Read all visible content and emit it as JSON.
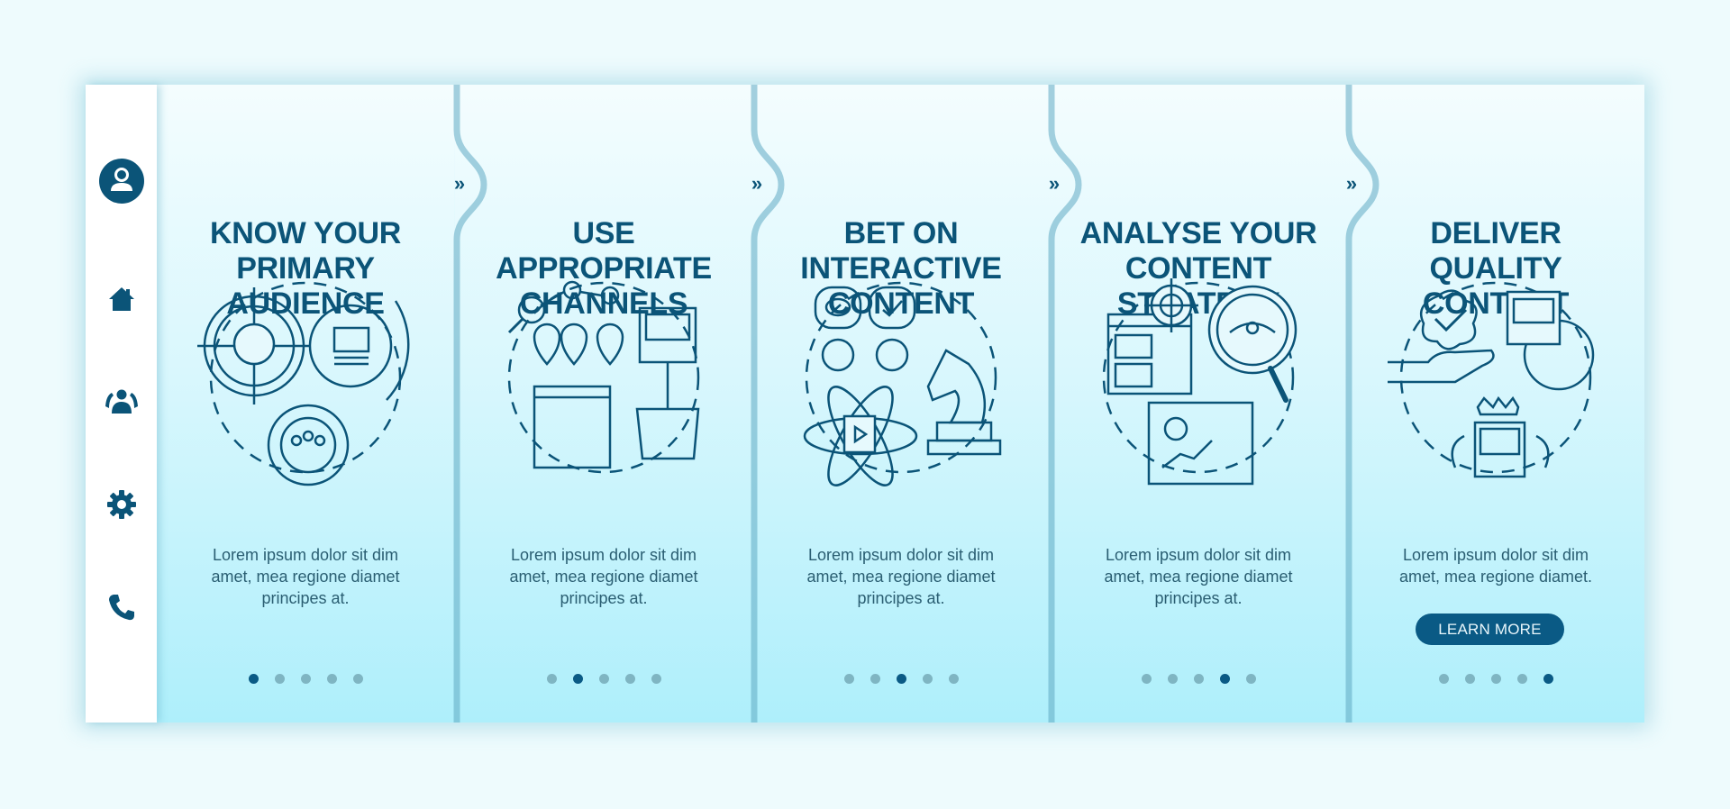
{
  "theme": {
    "primary": "#0b5478",
    "button": "#0a5a85",
    "dot_inactive": "#7fb5c2",
    "background": "#eefbfd",
    "panel_top": "#f4fdfe",
    "panel_bottom": "#aeeffb"
  },
  "sidebar": {
    "items": [
      {
        "icon": "user-icon",
        "label": "Profile"
      },
      {
        "icon": "home-icon",
        "label": "Home"
      },
      {
        "icon": "group-icon",
        "label": "Community"
      },
      {
        "icon": "gear-icon",
        "label": "Settings"
      },
      {
        "icon": "phone-icon",
        "label": "Contact"
      }
    ]
  },
  "next_chevron": "»",
  "panels": [
    {
      "title": [
        "KNOW YOUR",
        "PRIMARY",
        "AUDIENCE"
      ],
      "body": [
        "Lorem ipsum dolor sit dim",
        "amet, mea regione diamet",
        "principes at."
      ],
      "illustration": "audience-target-illustration",
      "active_dot": 1
    },
    {
      "title": [
        "USE",
        "APPROPRIATE",
        "CHANNELS"
      ],
      "body": [
        "Lorem ipsum dolor sit dim",
        "amet, mea regione diamet",
        "principes at."
      ],
      "illustration": "channels-locations-illustration",
      "active_dot": 2
    },
    {
      "title": [
        "BET ON",
        "INTERACTIVE",
        "CONTENT"
      ],
      "body": [
        "Lorem ipsum dolor sit dim",
        "amet, mea regione diamet",
        "principes at."
      ],
      "illustration": "interactive-content-illustration",
      "active_dot": 3
    },
    {
      "title": [
        "ANALYSE YOUR",
        "CONTENT",
        "STRATEGY"
      ],
      "body": [
        "Lorem ipsum dolor sit dim",
        "amet, mea regione diamet",
        "principes at."
      ],
      "illustration": "strategy-analysis-illustration",
      "active_dot": 4
    },
    {
      "title": [
        "DELIVER",
        "QUALITY",
        "CONTENT"
      ],
      "body": [
        "Lorem ipsum dolor sit dim",
        "amet, mea regione diamet."
      ],
      "illustration": "quality-content-illustration",
      "active_dot": 5,
      "button": "LEARN MORE"
    }
  ],
  "pagination": {
    "total": 5
  }
}
